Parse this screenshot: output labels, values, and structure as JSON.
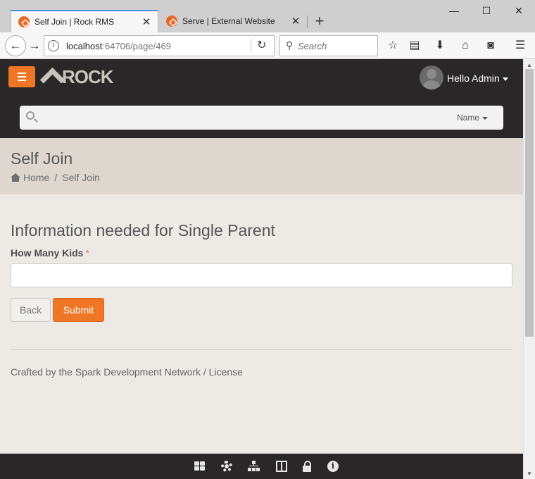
{
  "browser": {
    "tabs": [
      {
        "title": "Self Join | Rock RMS",
        "active": true
      },
      {
        "title": "Serve | External Website",
        "active": false
      }
    ],
    "new_tab_label": "+",
    "url_host": "localhost",
    "url_path": ":64706/page/469",
    "search_placeholder": "Search",
    "window_controls": {
      "minimize": "—",
      "maximize": "☐",
      "close": "✕"
    }
  },
  "header": {
    "logo_text": "ROCK",
    "user_greeting": "Hello Admin",
    "search_filter": "Name"
  },
  "page": {
    "title": "Self Join",
    "breadcrumb": {
      "home": "Home",
      "separator": "/",
      "current": "Self Join"
    }
  },
  "form": {
    "heading": "Information needed for Single Parent",
    "field_label": "How Many Kids",
    "required_marker": "*",
    "field_value": "",
    "back_label": "Back",
    "submit_label": "Submit"
  },
  "footer": {
    "text": "Crafted by the Spark Development Network / License"
  },
  "admin_toolbar": {
    "icons": [
      "blocks-icon",
      "gear-icon",
      "sitemap-icon",
      "zone-icon",
      "lock-icon",
      "info-icon"
    ]
  },
  "colors": {
    "accent": "#ee7625",
    "header_bg": "#292727",
    "page_header_bg": "#ddd7cf",
    "body_bg": "#edeae6"
  }
}
